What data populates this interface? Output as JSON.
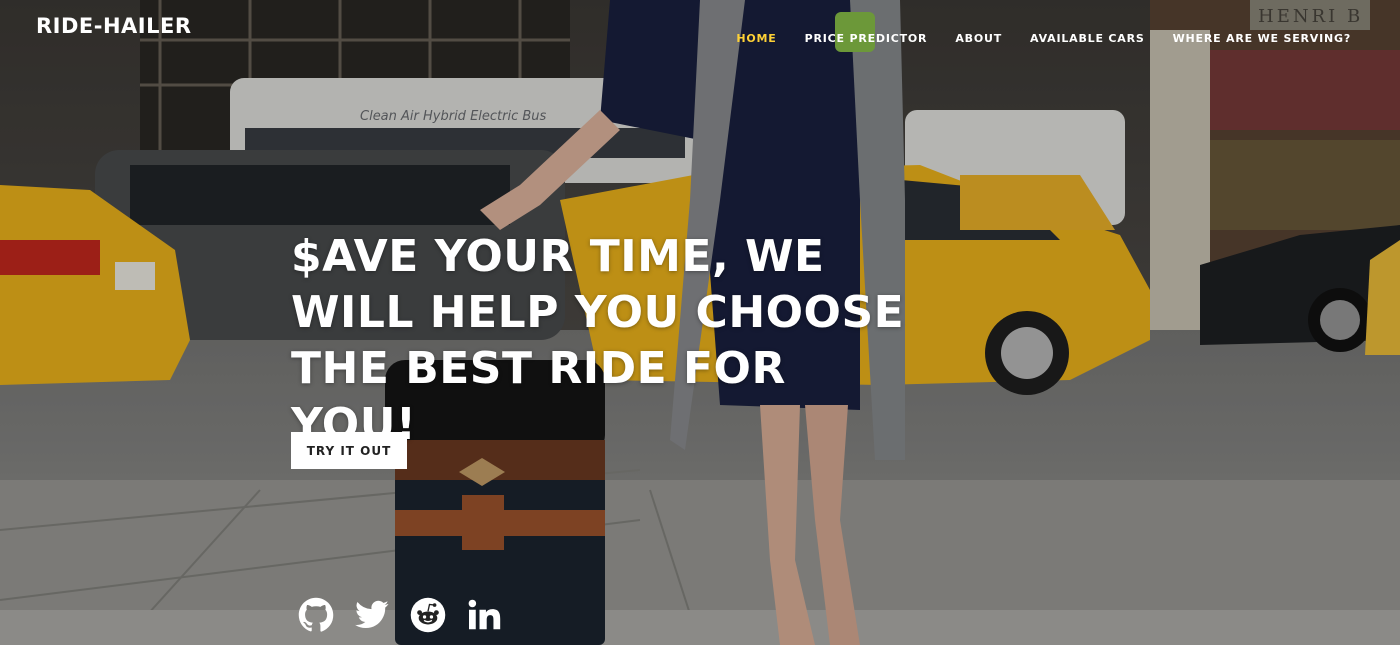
{
  "brand": {
    "name": "RIDE-HAILER"
  },
  "nav": {
    "items": [
      {
        "label": "HOME",
        "active": true
      },
      {
        "label": "PRICE PREDICTOR",
        "active": false
      },
      {
        "label": "ABOUT",
        "active": false
      },
      {
        "label": "AVAILABLE CARS",
        "active": false
      },
      {
        "label": "WHERE ARE WE SERVING?",
        "active": false
      }
    ]
  },
  "hero": {
    "headline": "$AVE YOUR TIME, WE WILL HELP YOU CHOOSE THE BEST RIDE FOR YOU!",
    "cta_label": "TRY IT OUT",
    "bus_sign": "Clean Air Hybrid Electric Bus",
    "storefront_sign": "HENRI B"
  },
  "social": [
    {
      "icon": "github-icon"
    },
    {
      "icon": "twitter-icon"
    },
    {
      "icon": "reddit-icon"
    },
    {
      "icon": "linkedin-icon"
    }
  ],
  "colors": {
    "accent": "#fed136",
    "text": "#ffffff",
    "taxi_yellow": "#f3b81c"
  }
}
